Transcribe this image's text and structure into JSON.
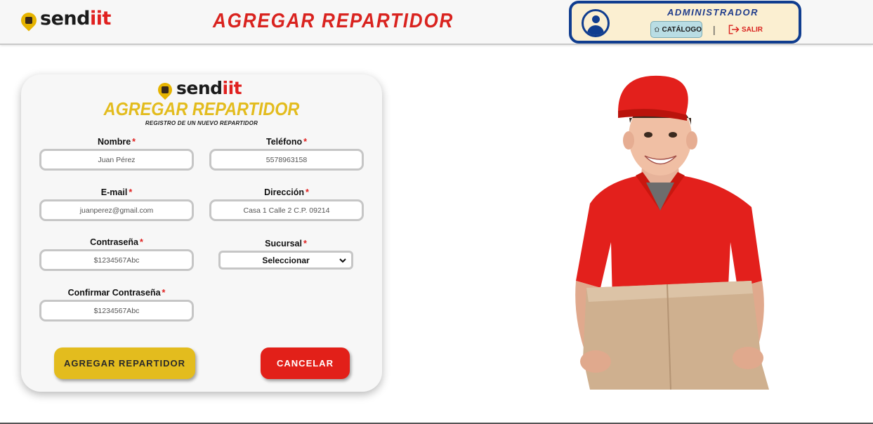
{
  "header": {
    "logo": {
      "part1": "send",
      "part2": "iit"
    },
    "title": "AGREGAR REPARTIDOR",
    "admin": {
      "role_label": "ADMINISTRADOR",
      "catalog_label": "CATÁLOGO",
      "separator": "|",
      "logout_label": "SALIR"
    }
  },
  "form": {
    "logo": {
      "part1": "send",
      "part2": "iit"
    },
    "title": "AGREGAR REPARTIDOR",
    "subtitle": "REGISTRO DE UN NUEVO REPARTIDOR",
    "required_mark": "*",
    "fields": {
      "nombre": {
        "label": "Nombre",
        "placeholder": "Juan Pérez"
      },
      "telefono": {
        "label": "Teléfono",
        "placeholder": "5578963158"
      },
      "email": {
        "label": "E-mail",
        "placeholder": "juanperez@gmail.com"
      },
      "direccion": {
        "label": "Dirección",
        "placeholder": "Casa 1 Calle 2 C.P. 09214"
      },
      "contrasena": {
        "label": "Contraseña",
        "placeholder": "$1234567Abc"
      },
      "sucursal": {
        "label": "Sucursal",
        "selected": "Seleccionar"
      },
      "confirmar": {
        "label": "Confirmar Contraseña",
        "placeholder": "$1234567Abc"
      }
    },
    "buttons": {
      "submit": "AGREGAR REPARTIDOR",
      "cancel": "CANCELAR"
    }
  },
  "colors": {
    "brand_red": "#e0201f",
    "brand_yellow": "#e3bc1e",
    "admin_border": "#103d8f",
    "admin_bg": "#fbefd1"
  },
  "icons": {
    "logo": "location-pin-icon",
    "avatar": "user-circle-icon",
    "catalog": "home-icon",
    "logout": "logout-icon",
    "select": "chevron-down-icon"
  }
}
